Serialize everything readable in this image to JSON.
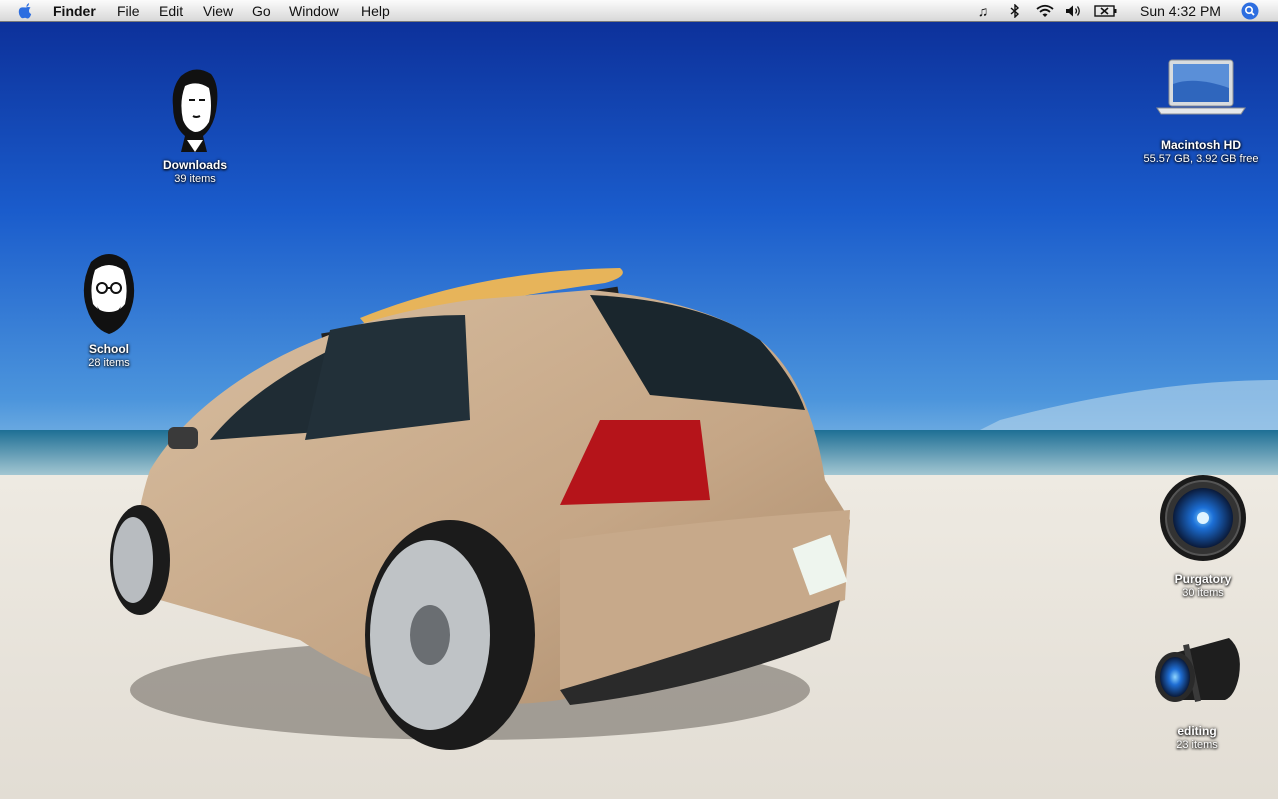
{
  "menubar": {
    "apple_icon": "apple-icon",
    "app_name": "Finder",
    "menus": [
      "File",
      "Edit",
      "View",
      "Go",
      "Window",
      "Help"
    ],
    "status_icons": [
      "itunes-note-icon",
      "bluetooth-icon",
      "wifi-icon",
      "volume-icon",
      "battery-icon"
    ],
    "clock": "Sun 4:32 PM",
    "spotlight_icon": "spotlight-search-icon"
  },
  "desktop_icons": [
    {
      "label": "Downloads",
      "sub": "39 items",
      "icon": "folder-face-icon"
    },
    {
      "label": "School",
      "sub": "28 items",
      "icon": "folder-face-icon"
    },
    {
      "label": "Macintosh HD",
      "sub": "55.57 GB, 3.92 GB free",
      "icon": "laptop-icon"
    },
    {
      "label": "Purgatory",
      "sub": "30 items",
      "icon": "camera-lens-icon"
    },
    {
      "label": "editing",
      "sub": "23 items",
      "icon": "camera-lens-icon"
    }
  ]
}
